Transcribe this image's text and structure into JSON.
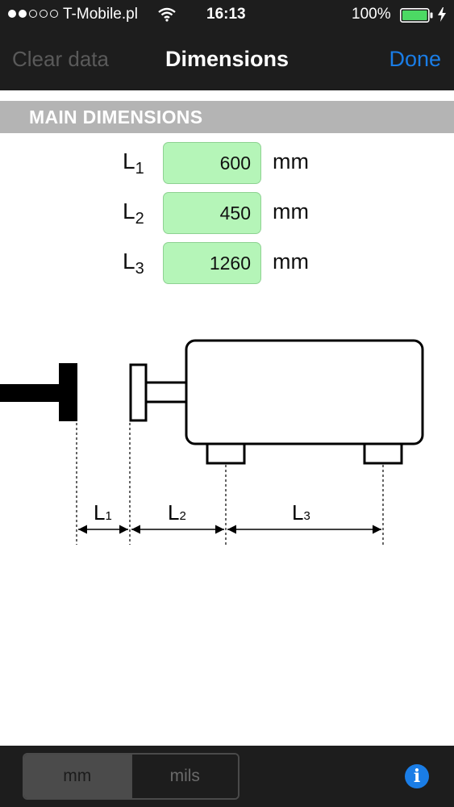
{
  "status_bar": {
    "carrier": "T-Mobile.pl",
    "time": "16:13",
    "battery_percent": "100%",
    "signal_bars": 2,
    "icons": [
      "wifi-icon",
      "battery-icon",
      "charging-bolt-icon"
    ]
  },
  "nav": {
    "left_label": "Clear data",
    "title": "Dimensions",
    "right_label": "Done"
  },
  "section": {
    "title": "MAIN DIMENSIONS"
  },
  "dimensions": [
    {
      "label": "L",
      "sub": "1",
      "value": "600",
      "unit": "mm"
    },
    {
      "label": "L",
      "sub": "2",
      "value": "450",
      "unit": "mm"
    },
    {
      "label": "L",
      "sub": "3",
      "value": "1260",
      "unit": "mm"
    }
  ],
  "diagram": {
    "labels": [
      {
        "label": "L",
        "sub": "1"
      },
      {
        "label": "L",
        "sub": "2"
      },
      {
        "label": "L",
        "sub": "3"
      }
    ]
  },
  "units": {
    "options": [
      "mm",
      "mils"
    ],
    "selected": "mm"
  },
  "colors": {
    "accent": "#1a7de6",
    "input_bg": "#b5f5b8",
    "bar_bg": "#1d1d1d",
    "section_bg": "#b4b4b4",
    "battery": "#4cd964"
  }
}
